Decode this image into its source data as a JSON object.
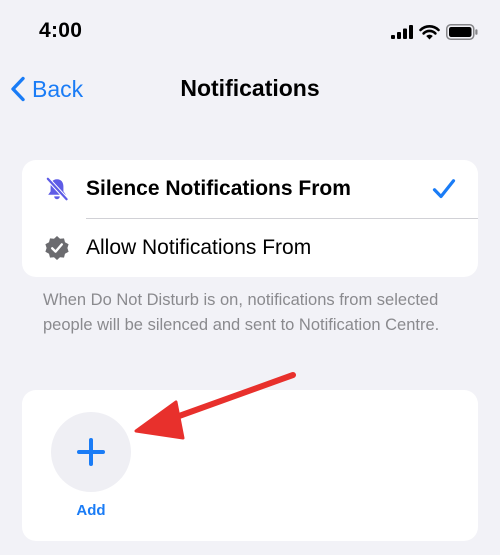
{
  "status_bar": {
    "time": "4:00"
  },
  "nav": {
    "back_label": "Back",
    "title": "Notifications"
  },
  "options": [
    {
      "label": "Silence Notifications From",
      "selected": true,
      "icon": "bell-slash-icon"
    },
    {
      "label": "Allow Notifications From",
      "selected": false,
      "icon": "checkmark-seal-icon"
    }
  ],
  "footer_note": "When Do Not Disturb is on, notifications from selected people will be silenced and sent to Notification Centre.",
  "add_card": {
    "button_label": "Add",
    "icon": "plus-icon"
  },
  "colors": {
    "accent": "#1a7cf6",
    "purple": "#5e5ce6",
    "arrow": "#e8302c",
    "background": "#f2f2f7"
  }
}
